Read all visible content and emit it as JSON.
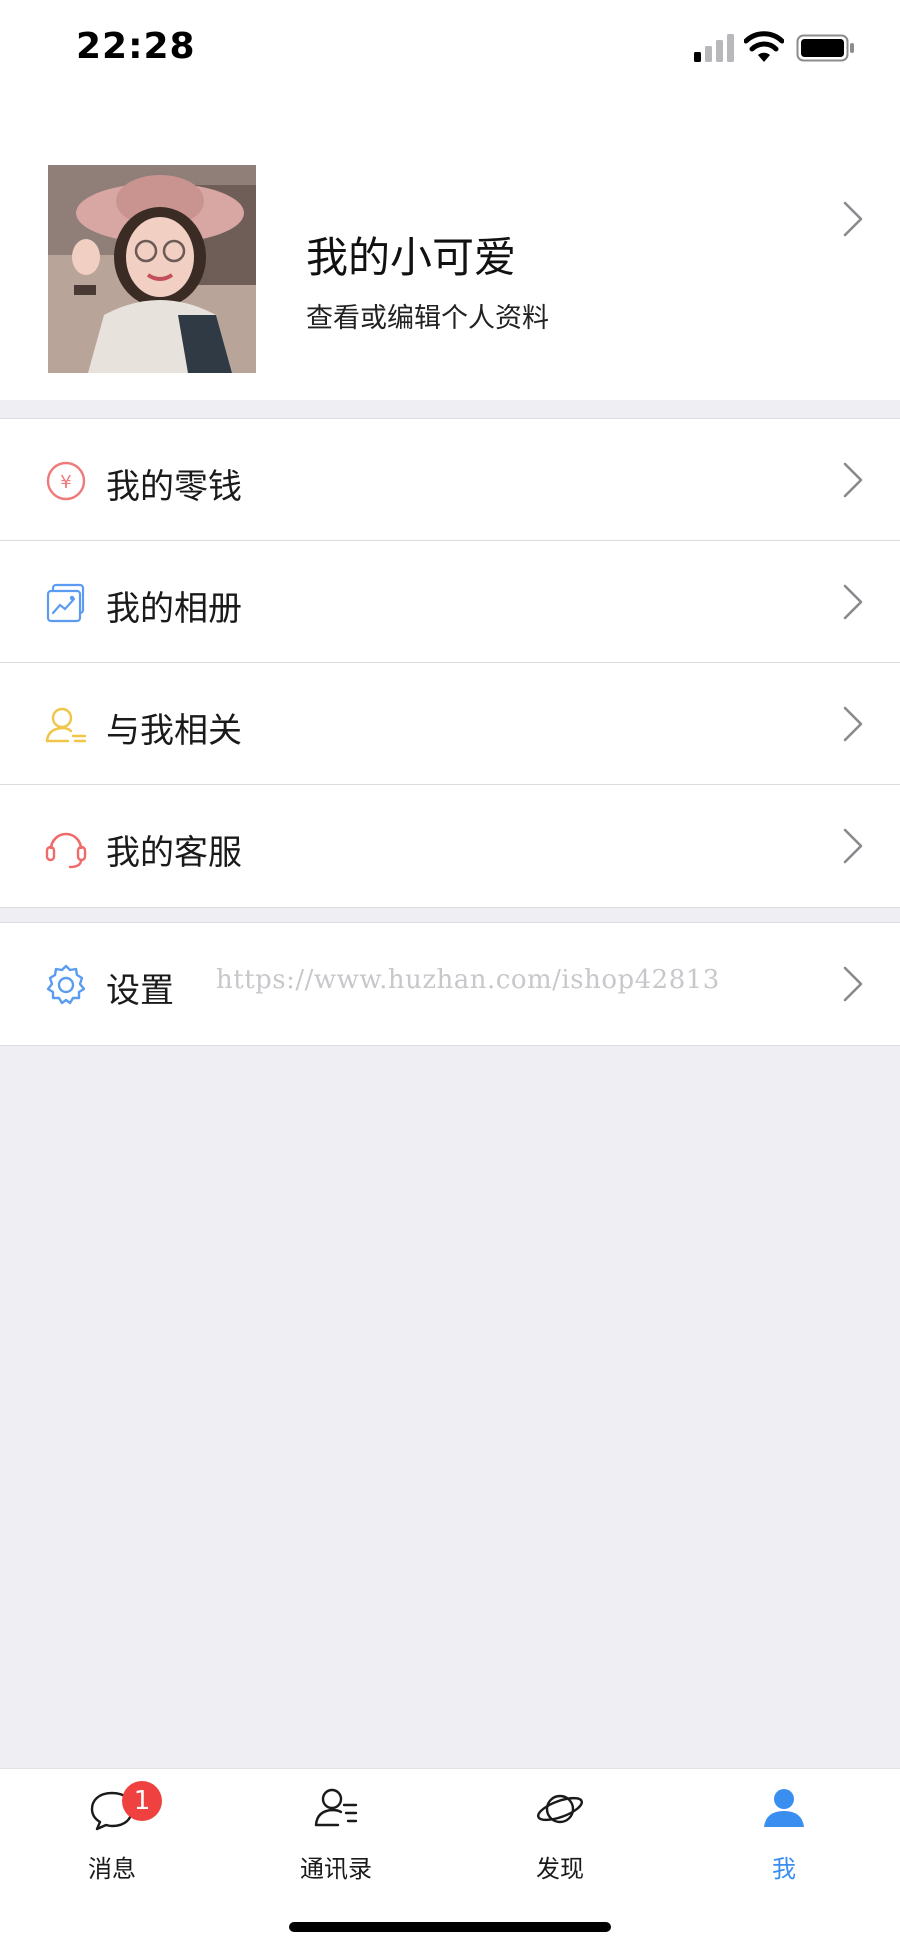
{
  "status_bar": {
    "time": "22:28"
  },
  "profile": {
    "name": "我的小可爱",
    "subtitle": "查看或编辑个人资料"
  },
  "menu": {
    "wallet": {
      "label": "我的零钱",
      "icon": "yen-icon"
    },
    "album": {
      "label": "我的相册",
      "icon": "album-icon"
    },
    "related": {
      "label": "与我相关",
      "icon": "user-list-icon"
    },
    "support": {
      "label": "我的客服",
      "icon": "headset-icon"
    },
    "settings": {
      "label": "设置",
      "icon": "gear-icon"
    }
  },
  "watermark": "https://www.huzhan.com/ishop42813",
  "tabbar": {
    "messages": {
      "label": "消息",
      "badge": "1"
    },
    "contacts": {
      "label": "通讯录"
    },
    "discover": {
      "label": "发现"
    },
    "me": {
      "label": "我"
    }
  },
  "colors": {
    "accent": "#3a8ef0",
    "badge": "#f04141",
    "wallet_icon": "#f07a7a",
    "album_icon": "#5b9cf0",
    "related_icon": "#f0c548",
    "support_icon": "#f06a6a",
    "settings_icon": "#5b9cf0"
  }
}
